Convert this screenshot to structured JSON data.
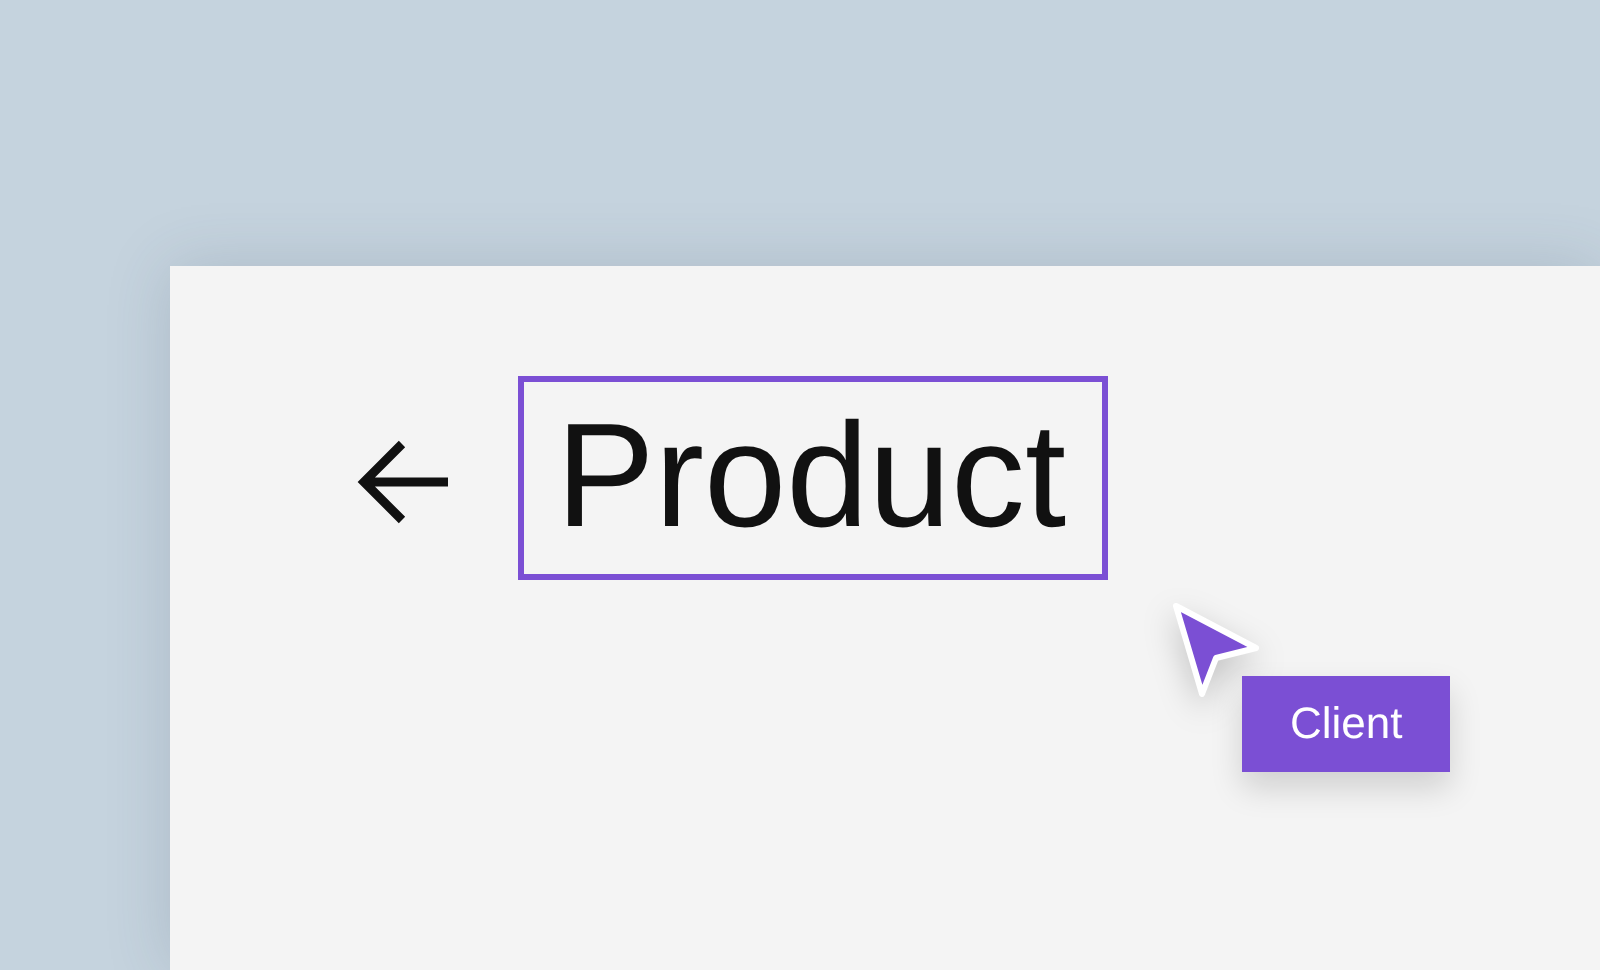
{
  "title": {
    "text": "Product",
    "selected": true
  },
  "cursor": {
    "label": "Client"
  }
}
